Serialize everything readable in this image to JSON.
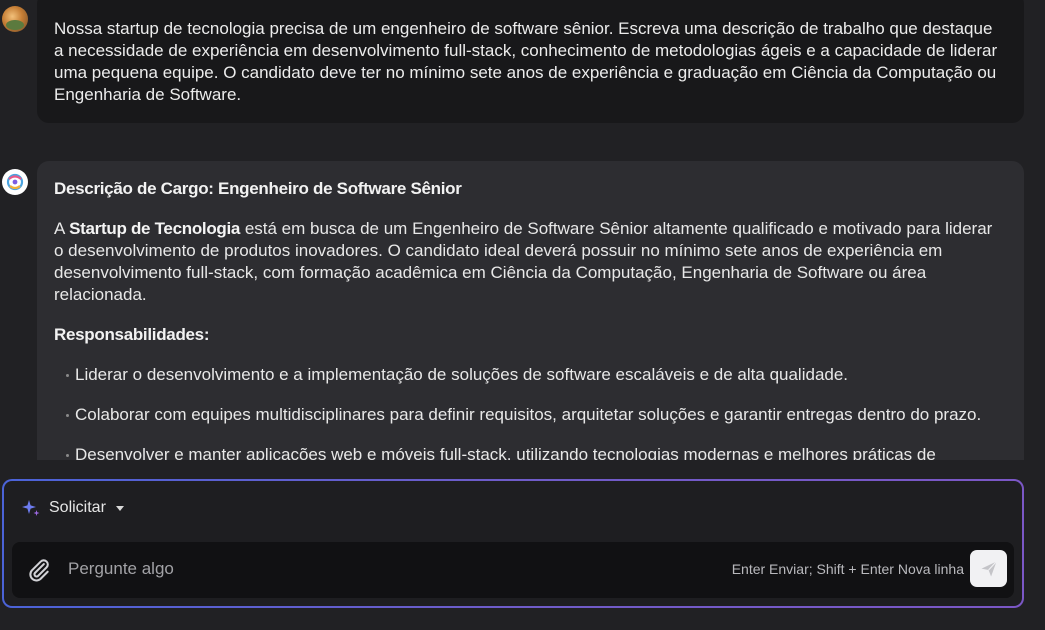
{
  "colors": {
    "background": "#212124",
    "user_bubble": "#18181a",
    "assistant_bubble": "#2d2d31",
    "composer_border_start": "#4b63d8",
    "composer_border_end": "#7b57c6",
    "send_button": "#f1f1f3"
  },
  "icons": {
    "user_avatar": "user-avatar",
    "assistant_avatar": "assistant-logo-icon",
    "mode": "sparkle-icon",
    "attach": "paperclip-icon",
    "send": "send-icon"
  },
  "user_message": {
    "text": "Nossa startup de tecnologia precisa de um engenheiro de software sênior. Escreva uma descrição de trabalho que destaque a necessidade de experiência em desenvolvimento full-stack, conhecimento de metodologias ágeis e a capacidade de liderar uma pequena equipe. O candidato deve ter no mínimo sete anos de experiência e graduação em Ciência da Computação ou Engenharia de Software."
  },
  "assistant_message": {
    "title": "Descrição de Cargo: Engenheiro de Software Sênior",
    "intro_prefix": "A ",
    "intro_bold": "Startup de Tecnologia",
    "intro_rest": " está em busca de um Engenheiro de Software Sênior altamente qualificado e motivado para liderar o desenvolvimento de produtos inovadores. O candidato ideal deverá possuir no mínimo sete anos de experiência em desenvolvimento full-stack, com formação acadêmica em Ciência da Computação, Engenharia de Software ou área relacionada.",
    "responsibilities_heading": "Responsabilidades:",
    "responsibilities": [
      "Liderar o desenvolvimento e a implementação de soluções de software escaláveis e de alta qualidade.",
      "Colaborar com equipes multidisciplinares para definir requisitos, arquitetar soluções e garantir entregas dentro do prazo.",
      "Desenvolver e manter aplicações web e móveis full-stack, utilizando tecnologias modernas e melhores práticas de engenharia de software."
    ]
  },
  "composer": {
    "mode_label": "Solicitar",
    "placeholder": "Pergunte algo",
    "hint": "Enter Enviar; Shift + Enter Nova linha"
  }
}
